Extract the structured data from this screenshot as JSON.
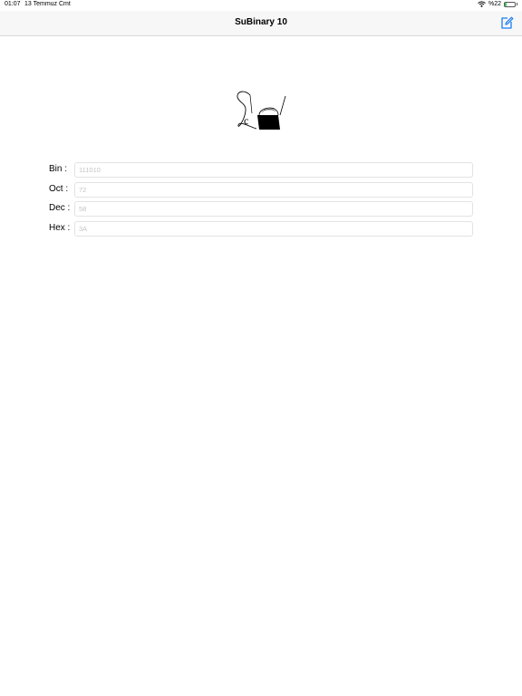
{
  "status_bar": {
    "time": "01:07",
    "date": "13 Temmuz Cmt",
    "battery_text": "%22",
    "battery_level": 0.22,
    "icons": [
      "wifi-icon",
      "battery-icon"
    ]
  },
  "navbar": {
    "title": "SuBinary 10",
    "compose_icon": "compose-icon",
    "accent_color": "#1a7cf5"
  },
  "logo": {
    "glyph": "c"
  },
  "fields": [
    {
      "label": "Bin :",
      "placeholder": "111010",
      "value": ""
    },
    {
      "label": "Oct :",
      "placeholder": "72",
      "value": ""
    },
    {
      "label": "Dec :",
      "placeholder": "58",
      "value": ""
    },
    {
      "label": "Hex :",
      "placeholder": "3A",
      "value": ""
    }
  ]
}
